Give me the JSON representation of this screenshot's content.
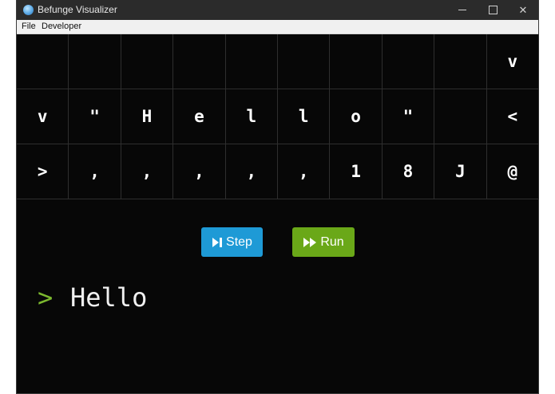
{
  "window": {
    "title": "Befunge Visualizer",
    "controls": {
      "minimize": "—",
      "maximize": "",
      "close": "✕"
    }
  },
  "menu": {
    "items": [
      "File",
      "Developer"
    ]
  },
  "grid": {
    "rows": [
      [
        "",
        "",
        "",
        "",
        "",
        "",
        "",
        "",
        "",
        "v"
      ],
      [
        "v",
        "\"",
        "H",
        "e",
        "l",
        "l",
        "o",
        "\"",
        "",
        "<"
      ],
      [
        ">",
        ",",
        ",",
        ",",
        ",",
        ",",
        "1",
        "8",
        "J",
        "@"
      ]
    ]
  },
  "buttons": {
    "step_label": "Step",
    "run_label": "Run",
    "step_color": "#1e9ad6",
    "run_color": "#6aa818"
  },
  "console": {
    "prompt": ">",
    "output": "Hello"
  }
}
